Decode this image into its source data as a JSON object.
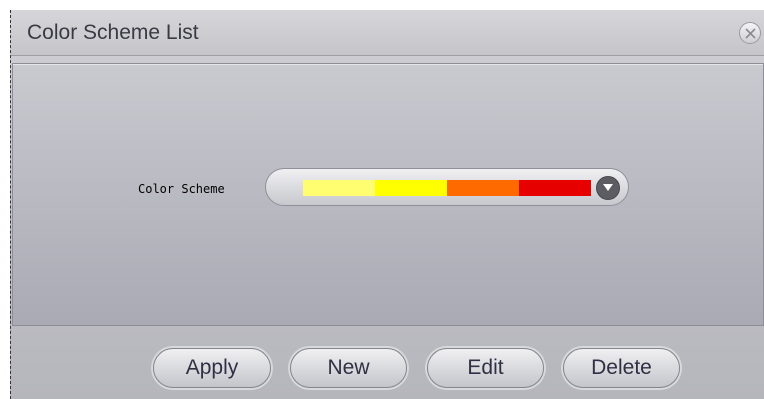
{
  "window": {
    "title": "Color Scheme List"
  },
  "form": {
    "color_scheme_label": "Color Scheme",
    "color_scheme_swatches": [
      "#fefe70",
      "#ffff00",
      "#ff6a00",
      "#e60000"
    ]
  },
  "buttons": {
    "apply": "Apply",
    "new": "New",
    "edit": "Edit",
    "delete": "Delete"
  },
  "icons": {
    "close": "close-icon",
    "dropdown": "chevron-down-icon"
  }
}
